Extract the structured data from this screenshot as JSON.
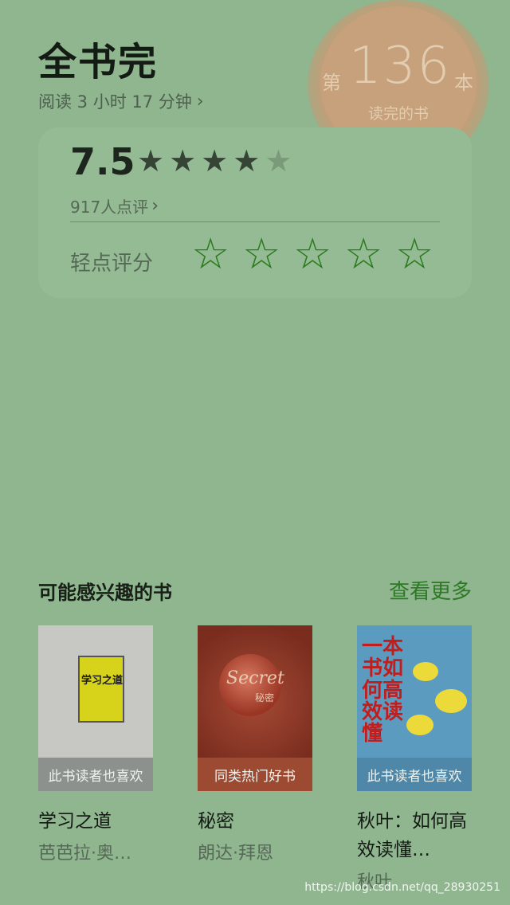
{
  "header": {
    "title": "全书完",
    "reading_time": "阅读 3 小时 17 分钟"
  },
  "badge": {
    "prefix": "第",
    "count": "136",
    "suffix": "本",
    "label": "读完的书"
  },
  "rating": {
    "score": "7.5",
    "stars_filled": 4,
    "stars_total": 5,
    "review_count": "917人点评",
    "tap_to_rate": "轻点评分",
    "rate_star_count": 5
  },
  "recommend": {
    "title": "可能感兴趣的书",
    "see_more": "查看更多",
    "books": [
      {
        "title": "学习之道",
        "author": "芭芭拉·奥…",
        "tag": "此书读者也喜欢",
        "cover_text": "学习之道"
      },
      {
        "title": "秘密",
        "author": "朗达·拜恩",
        "tag": "同类热门好书",
        "cover_text": "Secret",
        "cover_sub": "秘密"
      },
      {
        "title": "秋叶：如何高效读懂…",
        "author": "秋叶",
        "tag": "此书读者也喜欢",
        "cover_text": "一本书如何高效读懂"
      }
    ]
  },
  "watermark": "https://blog.csdn.net/qq_28930251",
  "colors": {
    "background": "#8fb68f",
    "accent_green": "#2d7a24",
    "badge": "#c7a17b"
  },
  "icons": {
    "chevron": "chevron-right-icon",
    "star": "star-icon",
    "star_outline": "star-outline-icon"
  }
}
